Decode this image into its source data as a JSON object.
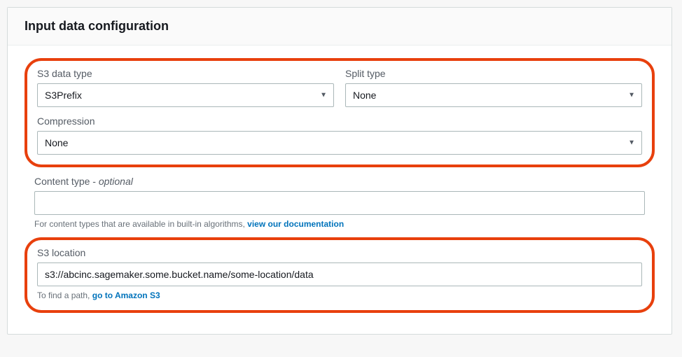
{
  "panel": {
    "title": "Input data configuration"
  },
  "fields": {
    "s3_data_type": {
      "label": "S3 data type",
      "value": "S3Prefix"
    },
    "split_type": {
      "label": "Split type",
      "value": "None"
    },
    "compression": {
      "label": "Compression",
      "value": "None"
    },
    "content_type": {
      "label": "Content type - ",
      "optional": "optional",
      "value": "",
      "helper_prefix": "For content types that are available in built-in algorithms, ",
      "helper_link": "view our documentation"
    },
    "s3_location": {
      "label": "S3 location",
      "value": "s3://abcinc.sagemaker.some.bucket.name/some-location/data",
      "helper_prefix": "To find a path, ",
      "helper_link": "go to Amazon S3"
    }
  }
}
